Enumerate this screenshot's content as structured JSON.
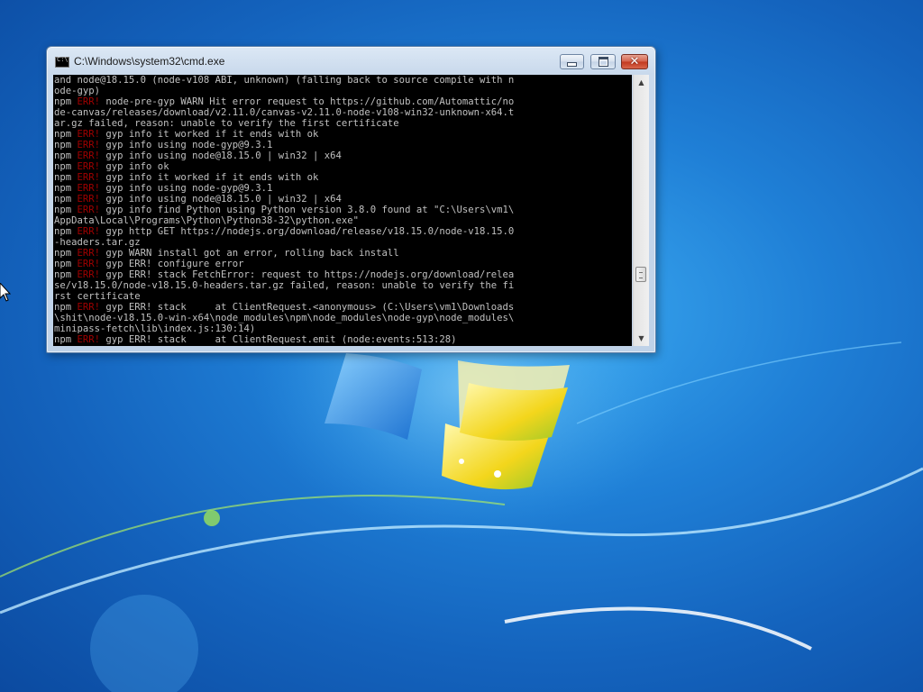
{
  "window": {
    "title": "C:\\Windows\\system32\\cmd.exe",
    "icon": "cmd-icon",
    "controls": {
      "minimize": "minimize-icon",
      "maximize": "maximize-icon",
      "close": "✕"
    }
  },
  "console": {
    "lines": [
      [
        {
          "t": "and node@18.15.0 (node-v108 ABI, unknown) (falling back to source compile with n"
        }
      ],
      [
        {
          "t": "ode-gyp)"
        }
      ],
      [
        {
          "t": "npm "
        },
        {
          "t": "ERR!",
          "err": true
        },
        {
          "t": " node-pre-gyp WARN Hit error request to https://github.com/Automattic/no"
        }
      ],
      [
        {
          "t": "de-canvas/releases/download/v2.11.0/canvas-v2.11.0-node-v108-win32-unknown-x64.t"
        }
      ],
      [
        {
          "t": "ar.gz failed, reason: unable to verify the first certificate"
        }
      ],
      [
        {
          "t": "npm "
        },
        {
          "t": "ERR!",
          "err": true
        },
        {
          "t": " gyp info it worked if it ends with ok"
        }
      ],
      [
        {
          "t": "npm "
        },
        {
          "t": "ERR!",
          "err": true
        },
        {
          "t": " gyp info using node-gyp@9.3.1"
        }
      ],
      [
        {
          "t": "npm "
        },
        {
          "t": "ERR!",
          "err": true
        },
        {
          "t": " gyp info using node@18.15.0 | win32 | x64"
        }
      ],
      [
        {
          "t": "npm "
        },
        {
          "t": "ERR!",
          "err": true
        },
        {
          "t": " gyp info ok"
        }
      ],
      [
        {
          "t": "npm "
        },
        {
          "t": "ERR!",
          "err": true
        },
        {
          "t": " gyp info it worked if it ends with ok"
        }
      ],
      [
        {
          "t": "npm "
        },
        {
          "t": "ERR!",
          "err": true
        },
        {
          "t": " gyp info using node-gyp@9.3.1"
        }
      ],
      [
        {
          "t": "npm "
        },
        {
          "t": "ERR!",
          "err": true
        },
        {
          "t": " gyp info using node@18.15.0 | win32 | x64"
        }
      ],
      [
        {
          "t": "npm "
        },
        {
          "t": "ERR!",
          "err": true
        },
        {
          "t": " gyp info find Python using Python version 3.8.0 found at \"C:\\Users\\vm1\\"
        }
      ],
      [
        {
          "t": "AppData\\Local\\Programs\\Python\\Python38-32\\python.exe\""
        }
      ],
      [
        {
          "t": "npm "
        },
        {
          "t": "ERR!",
          "err": true
        },
        {
          "t": " gyp http GET https://nodejs.org/download/release/v18.15.0/node-v18.15.0"
        }
      ],
      [
        {
          "t": "-headers.tar.gz"
        }
      ],
      [
        {
          "t": "npm "
        },
        {
          "t": "ERR!",
          "err": true
        },
        {
          "t": " gyp WARN install got an error, rolling back install"
        }
      ],
      [
        {
          "t": "npm "
        },
        {
          "t": "ERR!",
          "err": true
        },
        {
          "t": " gyp ERR! configure error"
        }
      ],
      [
        {
          "t": "npm "
        },
        {
          "t": "ERR!",
          "err": true
        },
        {
          "t": " gyp ERR! stack FetchError: request to https://nodejs.org/download/relea"
        }
      ],
      [
        {
          "t": "se/v18.15.0/node-v18.15.0-headers.tar.gz failed, reason: unable to verify the fi"
        }
      ],
      [
        {
          "t": "rst certificate"
        }
      ],
      [
        {
          "t": "npm "
        },
        {
          "t": "ERR!",
          "err": true
        },
        {
          "t": " gyp ERR! stack     at ClientRequest.<anonymous> (C:\\Users\\vm1\\Downloads"
        }
      ],
      [
        {
          "t": "\\shit\\node-v18.15.0-win-x64\\node_modules\\npm\\node_modules\\node-gyp\\node_modules\\"
        }
      ],
      [
        {
          "t": "minipass-fetch\\lib\\index.js:130:14)"
        }
      ],
      [
        {
          "t": "npm "
        },
        {
          "t": "ERR!",
          "err": true
        },
        {
          "t": " gyp ERR! stack     at ClientRequest.emit (node:events:513:28)"
        }
      ]
    ]
  },
  "colors": {
    "console_bg": "#000000",
    "console_text": "#c0c0c0",
    "error_red": "#a00000",
    "desktop_blue": "#1f7fd6"
  },
  "desktop": {
    "wallpaper": "windows-7-logo",
    "cursor": "mouse-pointer-icon"
  }
}
